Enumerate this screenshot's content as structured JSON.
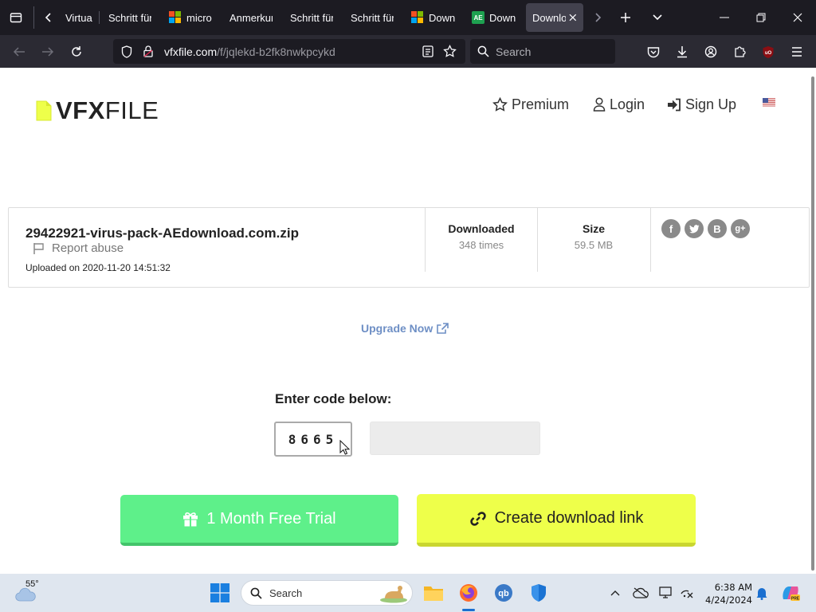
{
  "browser": {
    "tabs": [
      {
        "label": "Virtua",
        "icon": "none"
      },
      {
        "label": "Schritt für",
        "icon": "none"
      },
      {
        "label": "micro",
        "icon": "microsoft-logo"
      },
      {
        "label": "Anmerkun",
        "icon": "none"
      },
      {
        "label": "Schritt für",
        "icon": "none"
      },
      {
        "label": "Schritt für",
        "icon": "none"
      },
      {
        "label": "Down",
        "icon": "microsoft-logo"
      },
      {
        "label": "Down",
        "icon": "ae-logo"
      },
      {
        "label": "Downlo",
        "icon": "none",
        "active": true
      }
    ],
    "url_host": "vfxfile.com",
    "url_path": "/f/jqlekd-b2fk8nwkpcykd",
    "search_placeholder": "Search"
  },
  "site": {
    "logo_bold": "VFX",
    "logo_light": "FILE",
    "nav": {
      "premium": "Premium",
      "login": "Login",
      "signup": "Sign Up"
    },
    "accent_color": "#eeff4a"
  },
  "file": {
    "name": "29422921-virus-pack-AEdownload.com.zip",
    "report_label": "Report abuse",
    "uploaded": "Uploaded on 2020-11-20 14:51:32",
    "downloaded_label": "Downloaded",
    "downloaded_value": "348 times",
    "size_label": "Size",
    "size_value": "59.5 MB",
    "social": [
      "f",
      "t",
      "B",
      "g+"
    ]
  },
  "upgrade_label": "Upgrade Now",
  "captcha": {
    "label": "Enter code below:",
    "code": "8665",
    "input_value": ""
  },
  "buttons": {
    "trial": "1 Month Free Trial",
    "create": "Create download link"
  },
  "taskbar": {
    "weather_temp": "55°",
    "search_placeholder": "Search",
    "time": "6:38 AM",
    "date": "4/24/2024"
  }
}
